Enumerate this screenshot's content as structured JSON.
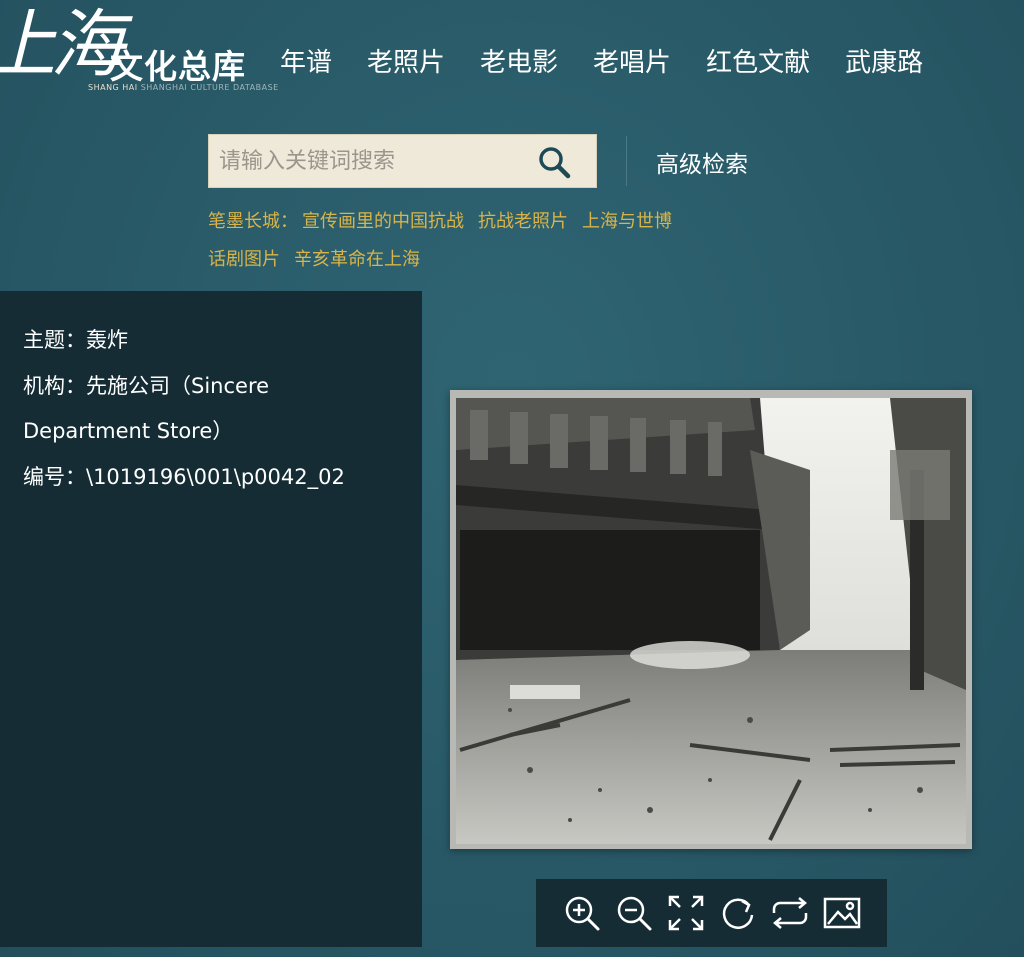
{
  "header": {
    "logo_calligraphy": "上海",
    "logo_title": "文化总库",
    "logo_sub": "SHANG HAI",
    "logo_sub_faded": "SHANGHAI CULTURE DATABASE"
  },
  "nav": [
    "年谱",
    "老照片",
    "老电影",
    "老唱片",
    "红色文献",
    "武康路"
  ],
  "search": {
    "placeholder": "请输入关键词搜索",
    "value": "",
    "advanced_label": "高级检索"
  },
  "hot_links": {
    "line1": [
      "笔墨长城：",
      "宣传画里的中国抗战",
      "抗战老照片",
      "上海与世博"
    ],
    "line2": [
      "话剧图片",
      "辛亥革命在上海"
    ]
  },
  "info": {
    "subject": "主题：轰炸",
    "institution_1": "机构：先施公司（Sincere",
    "institution_2": "Department Store）",
    "number": "编号：\\1019196\\001\\p0042_02"
  },
  "colors": {
    "background": "#2a5c69",
    "panel": "#152c35",
    "link": "#d8b44a",
    "search_bg": "#efe9da"
  },
  "toolbar": {
    "tools": [
      "zoom-in-icon",
      "zoom-out-icon",
      "fullscreen-icon",
      "rotate-icon",
      "swap-icon",
      "image-icon"
    ]
  }
}
